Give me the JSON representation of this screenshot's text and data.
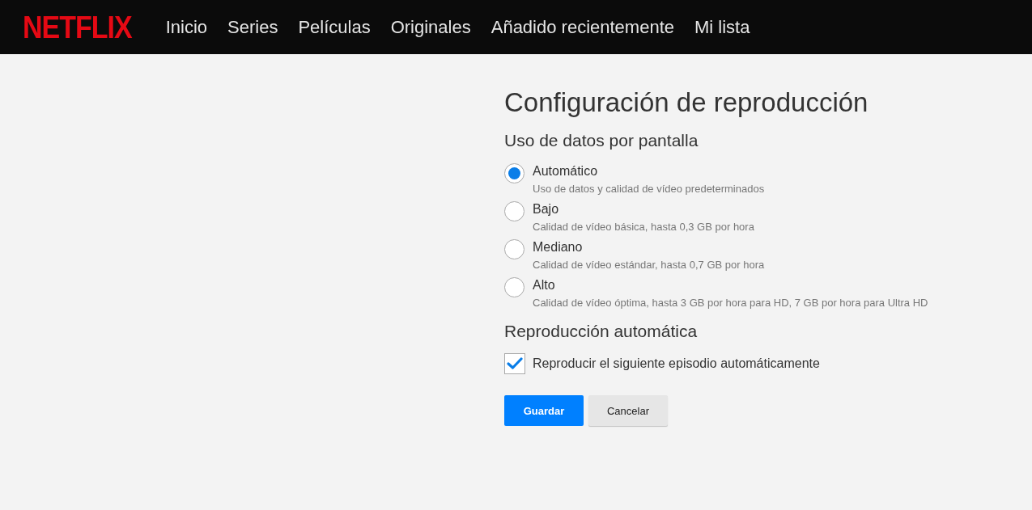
{
  "header": {
    "logo": "NETFLIX",
    "nav": [
      {
        "label": "Inicio"
      },
      {
        "label": "Series"
      },
      {
        "label": "Películas"
      },
      {
        "label": "Originales"
      },
      {
        "label": "Añadido recientemente"
      },
      {
        "label": "Mi lista"
      }
    ]
  },
  "title": "Configuración de reproducción",
  "data_usage": {
    "heading": "Uso de datos por pantalla",
    "options": [
      {
        "label": "Automático",
        "description": "Uso de datos y calidad de vídeo predeterminados",
        "selected": true
      },
      {
        "label": "Bajo",
        "description": "Calidad de vídeo básica, hasta 0,3 GB por hora",
        "selected": false
      },
      {
        "label": "Mediano",
        "description": "Calidad de vídeo estándar, hasta 0,7 GB por hora",
        "selected": false
      },
      {
        "label": "Alto",
        "description": "Calidad de vídeo óptima, hasta 3 GB por hora para HD, 7 GB por hora para Ultra HD",
        "selected": false
      }
    ]
  },
  "autoplay": {
    "heading": "Reproducción automática",
    "checkbox": {
      "label": "Reproducir el siguiente episodio automáticamente",
      "checked": true
    }
  },
  "buttons": [
    {
      "label": "Guardar",
      "kind": "primary"
    },
    {
      "label": "Cancelar",
      "kind": "secondary"
    }
  ]
}
